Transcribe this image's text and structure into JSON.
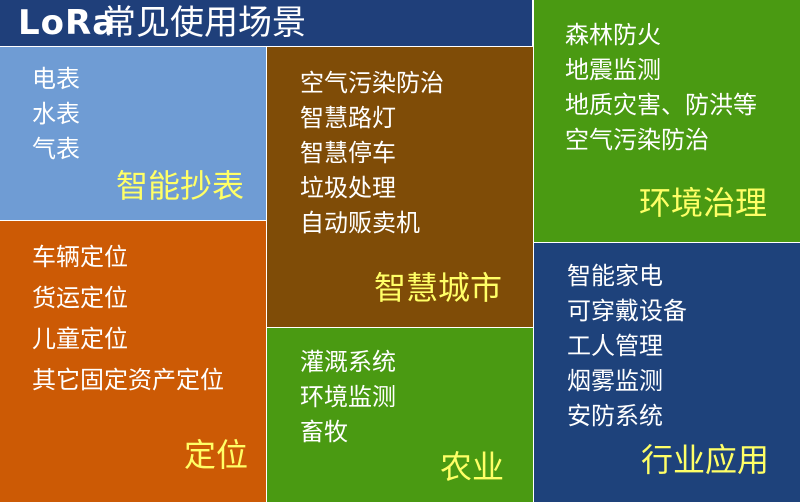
{
  "header": {
    "brand": "LoRa",
    "title": "常见使用场景"
  },
  "blocks": {
    "meter": {
      "label": "智能抄表",
      "items": [
        "电表",
        "水表",
        "气表"
      ]
    },
    "city": {
      "label": "智慧城市",
      "items": [
        "空气污染防治",
        "智慧路灯",
        "智慧停车",
        "垃圾处理",
        "自动贩卖机"
      ]
    },
    "env": {
      "label": "环境治理",
      "items": [
        "森林防火",
        "地震监测",
        "地质灾害、防洪等",
        "空气污染防治"
      ]
    },
    "positioning": {
      "label": "定位",
      "items": [
        "车辆定位",
        "货运定位",
        "儿童定位",
        "其它固定资产定位"
      ]
    },
    "agri": {
      "label": "农业",
      "items": [
        "灌溉系统",
        "环境监测",
        "畜牧"
      ]
    },
    "industry": {
      "label": "行业应用",
      "items": [
        "智能家电",
        "可穿戴设备",
        "工人管理",
        "烟雾监测",
        "安防系统"
      ]
    }
  },
  "colors": {
    "title_bg": "#1f3f7a",
    "meter_bg": "#6f9cd4",
    "city_bg": "#7f4c07",
    "env_bg": "#4a9a12",
    "positioning_bg": "#cc5a05",
    "agri_bg": "#4a9a12",
    "industry_bg": "#1e427b",
    "label_color": "#ffff66",
    "item_color": "#ffffff"
  }
}
